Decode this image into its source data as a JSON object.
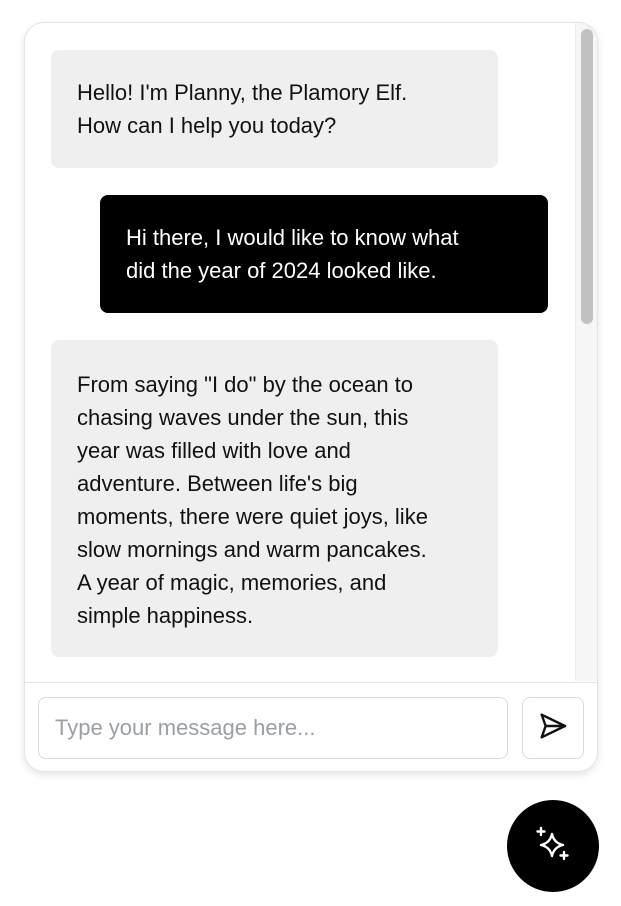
{
  "chat": {
    "messages": [
      {
        "role": "assistant",
        "text": "Hello! I'm Planny, the Plamory Elf.\nHow can I help you today?"
      },
      {
        "role": "user",
        "text": "Hi there, I would like to know what\ndid the year of 2024 looked like."
      },
      {
        "role": "assistant",
        "text": "From saying \"I do\" by the ocean to\nchasing waves under the sun, this\nyear was filled with love and\nadventure. Between life's big\nmoments, there were quiet joys, like\nslow mornings and warm pancakes.\nA year of magic, memories, and\nsimple happiness."
      }
    ]
  },
  "composer": {
    "placeholder": "Type your message here...",
    "value": "",
    "send_icon": "send-icon"
  },
  "launcher": {
    "icon": "sparkles-icon"
  },
  "colors": {
    "assistant_bubble": "#efefef",
    "user_bubble": "#000000",
    "user_text": "#ffffff",
    "launcher": "#000000"
  }
}
